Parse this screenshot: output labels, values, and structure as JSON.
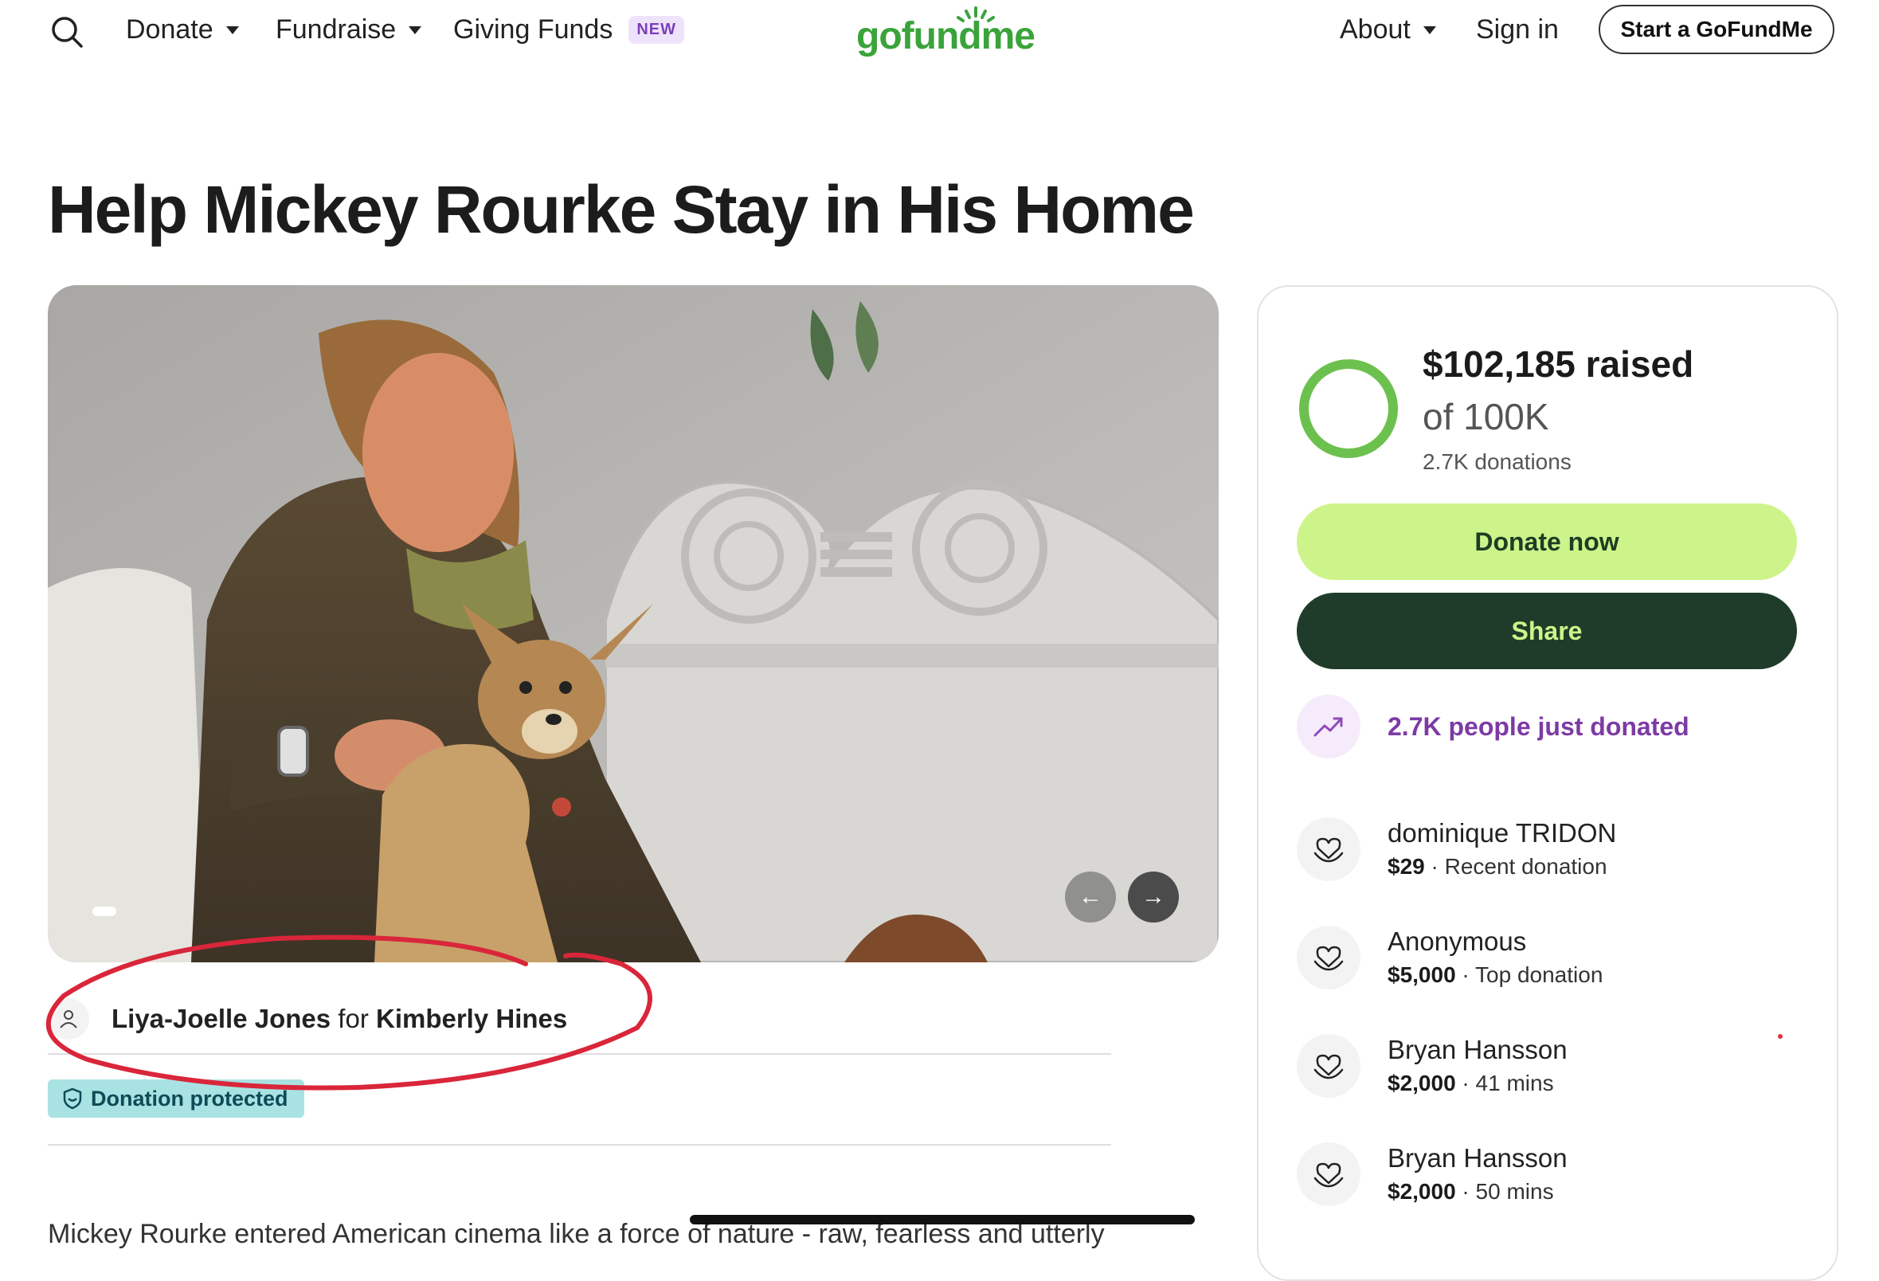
{
  "nav": {
    "donate": "Donate",
    "fundraise": "Fundraise",
    "giving_funds": "Giving Funds",
    "new_badge": "NEW",
    "logo": "gofundme",
    "about": "About",
    "sign_in": "Sign in",
    "start": "Start a GoFundMe"
  },
  "campaign": {
    "title": "Help Mickey Rourke Stay in His Home",
    "organizer": "Liya-Joelle Jones",
    "for_word": "for",
    "beneficiary": "Kimberly Hines",
    "protected": "Donation protected",
    "story_start": "Mickey Rourke entered American cinema like a force of nature - raw, fearless and utterly"
  },
  "card": {
    "raised": "$102,185 raised",
    "goal": "of 100K",
    "donations_count": "2.7K donations",
    "progress": 1.0,
    "donate_btn": "Donate now",
    "share_btn": "Share",
    "trend_text": "2.7K people just donated",
    "donors": [
      {
        "name": "dominique TRIDON",
        "amount": "$29",
        "note": "Recent donation"
      },
      {
        "name": "Anonymous",
        "amount": "$5,000",
        "note": "Top donation"
      },
      {
        "name": "Bryan Hansson",
        "amount": "$2,000",
        "note": "41 mins"
      },
      {
        "name": "Bryan Hansson",
        "amount": "$2,000",
        "note": "50 mins"
      }
    ]
  },
  "colors": {
    "brand_green": "#3aa33a",
    "donate_btn": "#cdf48a",
    "share_btn": "#1f3c2a",
    "trend_purple": "#7d3aa5",
    "annotation_red": "#d9263a"
  }
}
